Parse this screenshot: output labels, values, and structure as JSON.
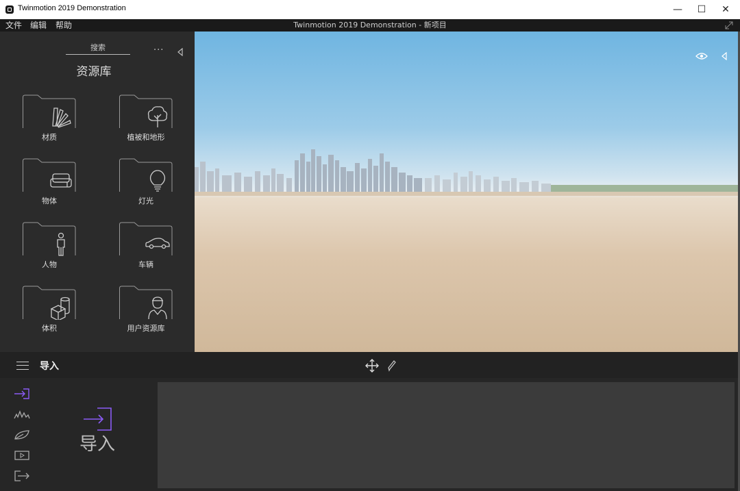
{
  "window": {
    "title": "Twinmotion 2019 Demonstration",
    "minimize_glyph": "—",
    "maximize_glyph": "☐",
    "close_glyph": "✕"
  },
  "menubar": {
    "items": [
      "文件",
      "编辑",
      "帮助"
    ],
    "document_title": "Twinmotion 2019 Demonstration - 新项目"
  },
  "library": {
    "search_label": "搜索",
    "title": "资源库",
    "more_label": "···",
    "categories": [
      {
        "label": "材质",
        "icon": "swatch-fan-icon"
      },
      {
        "label": "植被和地形",
        "icon": "tree-icon"
      },
      {
        "label": "物体",
        "icon": "sofa-icon"
      },
      {
        "label": "灯光",
        "icon": "lightbulb-icon"
      },
      {
        "label": "人物",
        "icon": "person-icon"
      },
      {
        "label": "车辆",
        "icon": "car-icon"
      },
      {
        "label": "体积",
        "icon": "cube-cylinder-icon"
      },
      {
        "label": "用户资源库",
        "icon": "user-library-icon"
      }
    ]
  },
  "toolbar": {
    "section_title": "导入"
  },
  "dock": {
    "import_label": "导入",
    "accent_color": "#8b5cf6"
  }
}
